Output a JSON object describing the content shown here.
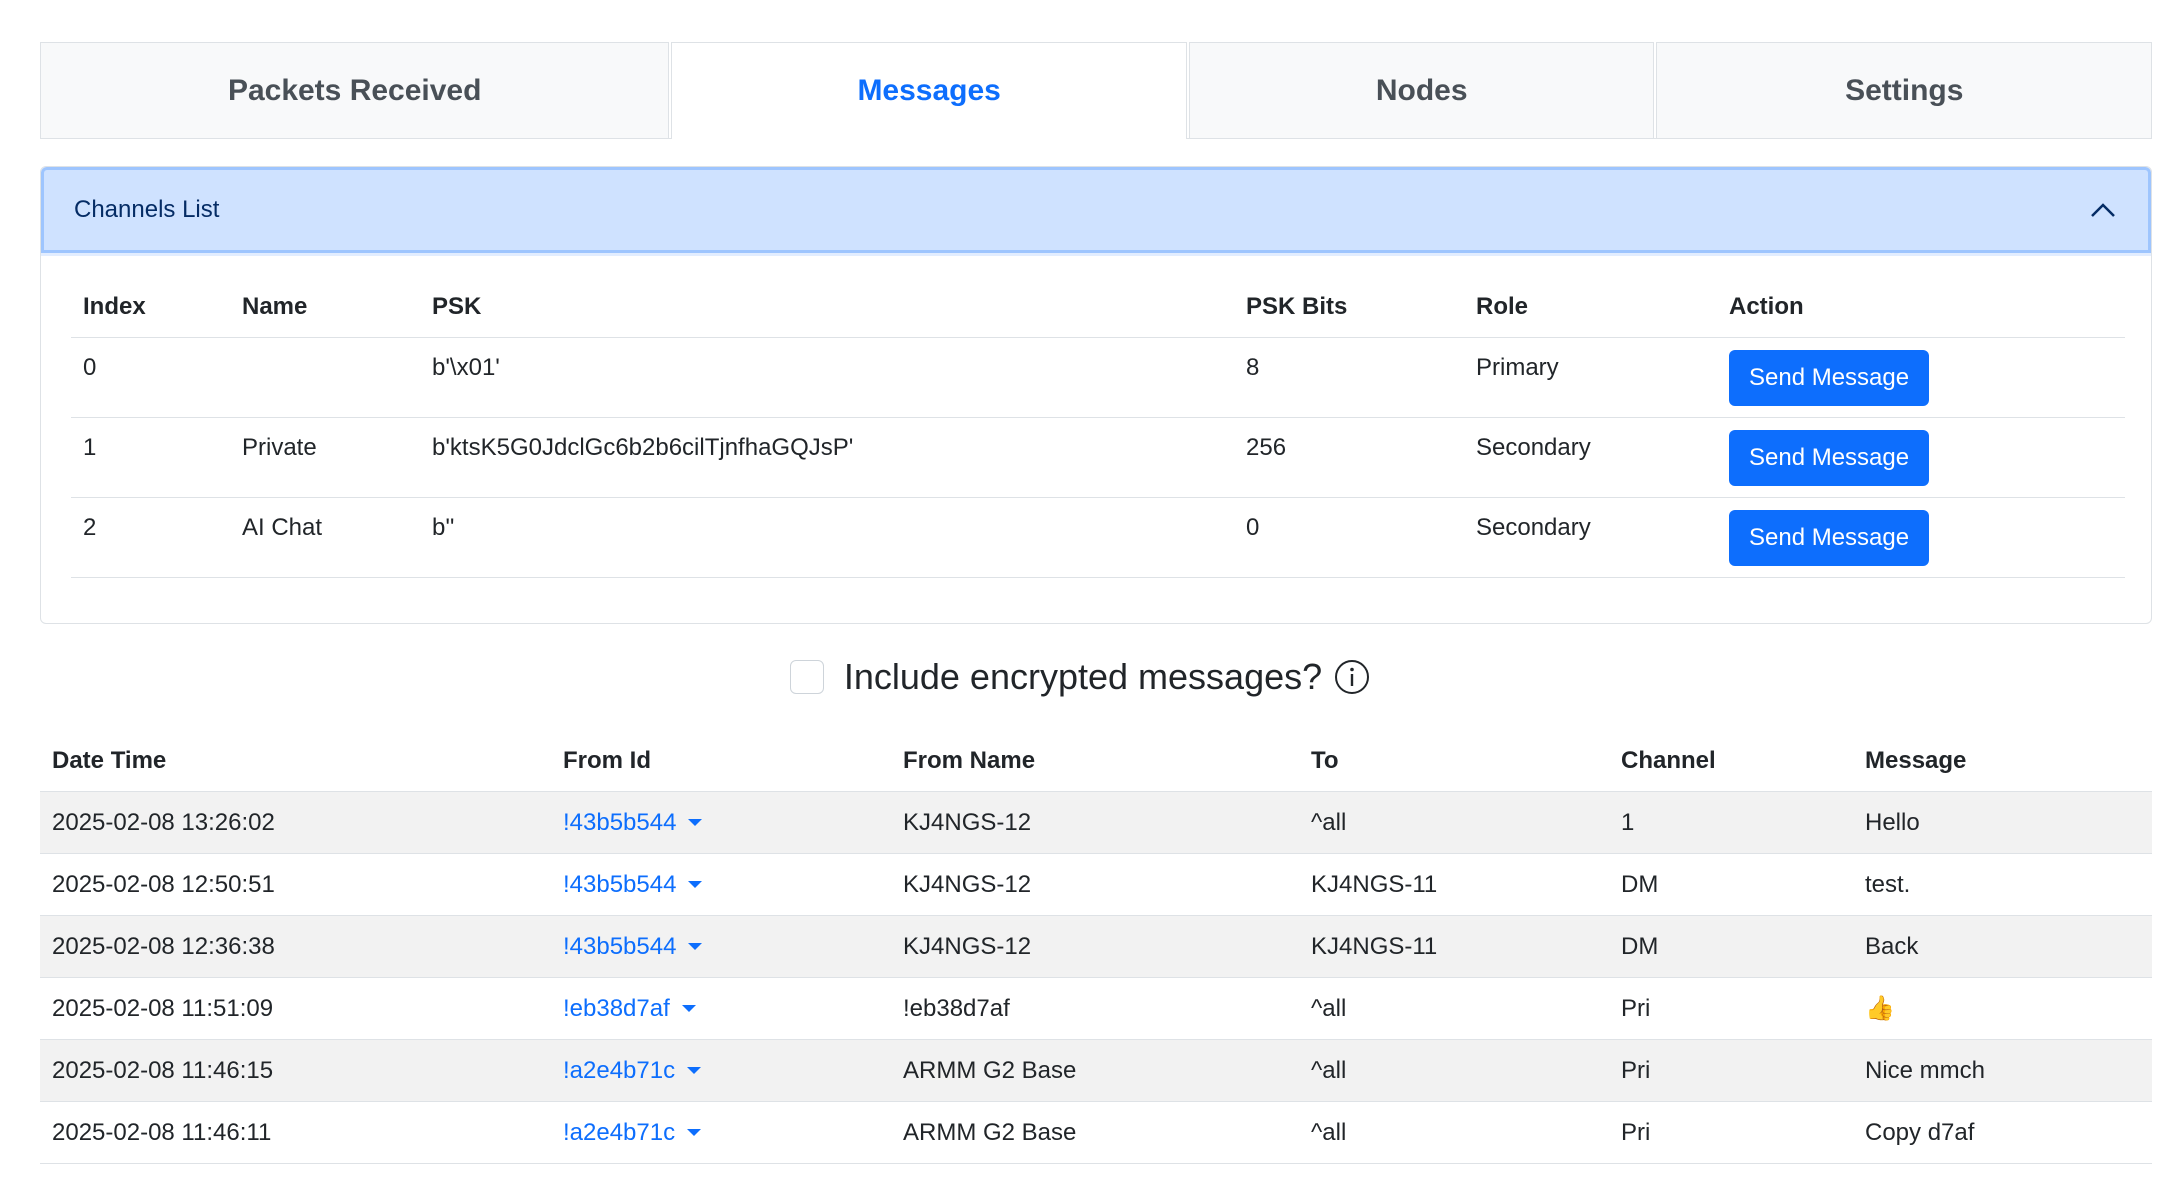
{
  "tabs": [
    {
      "label": "Packets Received"
    },
    {
      "label": "Messages"
    },
    {
      "label": "Nodes"
    },
    {
      "label": "Settings"
    }
  ],
  "active_tab": "Messages",
  "colors": {
    "accent": "#0d6efd",
    "accordion_bg": "#cfe2ff",
    "accordion_text": "#052c65",
    "stripe": "#f2f2f2"
  },
  "channels": {
    "title": "Channels List",
    "headers": {
      "index": "Index",
      "name": "Name",
      "psk": "PSK",
      "psk_bits": "PSK Bits",
      "role": "Role",
      "action": "Action"
    },
    "rows": [
      {
        "index": "0",
        "name": "",
        "psk": "b'\\x01'",
        "psk_bits": "8",
        "role": "Primary",
        "action": "Send Message"
      },
      {
        "index": "1",
        "name": "Private",
        "psk": "b'ktsK5G0JdclGc6b2b6cilTjnfhaGQJsP'",
        "psk_bits": "256",
        "role": "Secondary",
        "action": "Send Message"
      },
      {
        "index": "2",
        "name": "AI Chat",
        "psk": "b''",
        "psk_bits": "0",
        "role": "Secondary",
        "action": "Send Message"
      }
    ]
  },
  "encrypted_toggle": {
    "label": "Include encrypted messages?",
    "checked": false,
    "icon": "info-icon"
  },
  "messages": {
    "headers": {
      "date_time": "Date Time",
      "from_id": "From Id",
      "from_name": "From Name",
      "to": "To",
      "channel": "Channel",
      "message": "Message"
    },
    "rows": [
      {
        "date_time": "2025-02-08 13:26:02",
        "from_id": "!43b5b544",
        "from_name": "KJ4NGS-12",
        "to": "^all",
        "channel": "1",
        "message": "Hello"
      },
      {
        "date_time": "2025-02-08 12:50:51",
        "from_id": "!43b5b544",
        "from_name": "KJ4NGS-12",
        "to": "KJ4NGS-11",
        "channel": "DM",
        "message": "test."
      },
      {
        "date_time": "2025-02-08 12:36:38",
        "from_id": "!43b5b544",
        "from_name": "KJ4NGS-12",
        "to": "KJ4NGS-11",
        "channel": "DM",
        "message": "Back"
      },
      {
        "date_time": "2025-02-08 11:51:09",
        "from_id": "!eb38d7af",
        "from_name": "!eb38d7af",
        "to": "^all",
        "channel": "Pri",
        "message": "👍"
      },
      {
        "date_time": "2025-02-08 11:46:15",
        "from_id": "!a2e4b71c",
        "from_name": "ARMM G2 Base",
        "to": "^all",
        "channel": "Pri",
        "message": "Nice mmch"
      },
      {
        "date_time": "2025-02-08 11:46:11",
        "from_id": "!a2e4b71c",
        "from_name": "ARMM G2 Base",
        "to": "^all",
        "channel": "Pri",
        "message": "Copy d7af"
      }
    ]
  }
}
